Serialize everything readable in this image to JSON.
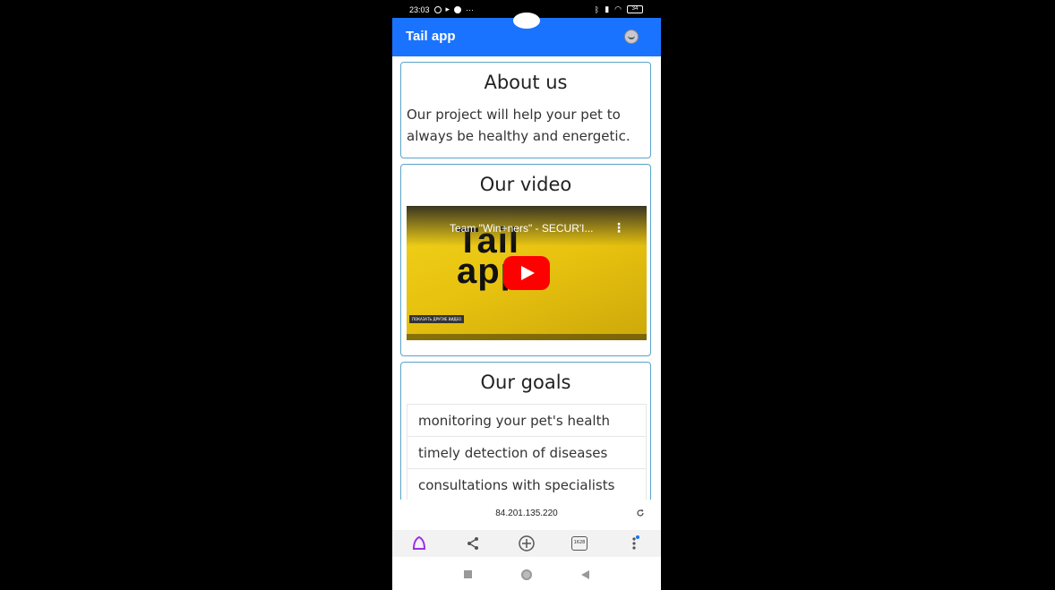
{
  "status_bar": {
    "time": "23:03",
    "overflow": "···",
    "battery": "34"
  },
  "app_bar": {
    "title": "Tail app",
    "avatar_icon": "avatar-emoji-icon",
    "color": "#1a73ff"
  },
  "about": {
    "title": "About us",
    "text": "Our project will help your pet to always be healthy and energetic."
  },
  "video": {
    "title": "Our video",
    "player_title": "Team \"Win+ners\" - SECUR'I...",
    "logo_line1": "Tail",
    "logo_line2": "app",
    "more_videos": "ПОКАЗАТЬ ДРУГИЕ ВИДЕО"
  },
  "goals": {
    "title": "Our goals",
    "items": [
      "monitoring your pet's health",
      "timely detection of diseases",
      "consultations with specialists"
    ]
  },
  "browser": {
    "url": "84.201.135.220",
    "tabs_count": "1628"
  }
}
